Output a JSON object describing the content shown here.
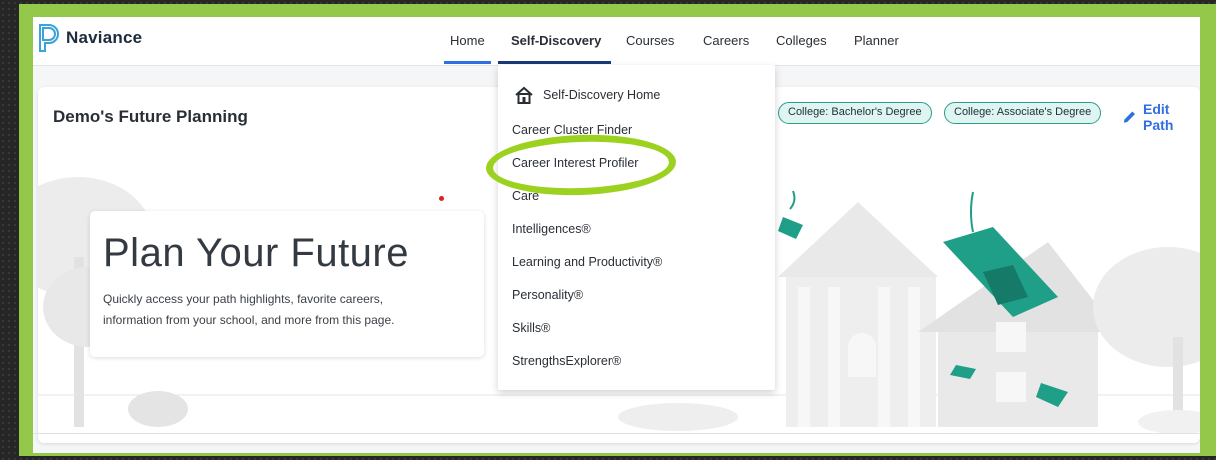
{
  "app": {
    "name": "Naviance"
  },
  "nav": {
    "items": [
      {
        "label": "Home"
      },
      {
        "label": "Self-Discovery"
      },
      {
        "label": "Courses"
      },
      {
        "label": "Careers"
      },
      {
        "label": "Colleges"
      },
      {
        "label": "Planner"
      }
    ]
  },
  "card": {
    "title": "Demo's Future Planning",
    "chips": [
      "College: Bachelor's Degree",
      "College: Associate's Degree"
    ],
    "edit_label": "Edit Path"
  },
  "hero": {
    "title": "Plan Your Future",
    "description": "Quickly access your path highlights, favorite careers, information from your school, and more from this page."
  },
  "dropdown": {
    "home_label": "Self-Discovery Home",
    "items": [
      "Career Cluster Finder",
      "Career Interest Profiler",
      "Care",
      "Intelligences®",
      "Learning and Productivity®",
      "Personality®",
      "Skills®",
      "StrengthsExplorer®"
    ]
  },
  "colors": {
    "frame": "#93c84a",
    "highlight": "#9dd11f",
    "accent": "#2f6fe0",
    "chip_border": "#2a9d8f",
    "cap_teal": "#1f9e88"
  },
  "icons": {
    "logo": "naviance-logo-icon",
    "home": "home-icon",
    "edit": "pencil-icon"
  }
}
